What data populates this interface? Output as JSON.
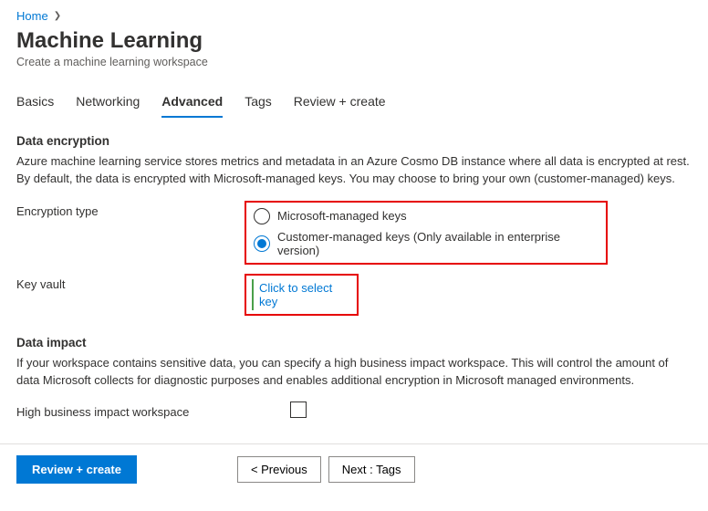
{
  "breadcrumb": {
    "home": "Home"
  },
  "header": {
    "title": "Machine Learning",
    "subtitle": "Create a machine learning workspace"
  },
  "tabs": {
    "basics": "Basics",
    "networking": "Networking",
    "advanced": "Advanced",
    "tags": "Tags",
    "review": "Review + create"
  },
  "encryption": {
    "section_title": "Data encryption",
    "desc": "Azure machine learning service stores metrics and metadata in an Azure Cosmo DB instance where all data is encrypted at rest. By default, the data is encrypted with Microsoft-managed keys. You may choose to bring your own (customer-managed) keys.",
    "type_label": "Encryption type",
    "option_microsoft": "Microsoft-managed keys",
    "option_customer": "Customer-managed keys (Only available in enterprise version)",
    "keyvault_label": "Key vault",
    "select_key_link": "Click to select key"
  },
  "impact": {
    "section_title": "Data impact",
    "desc": "If your workspace contains sensitive data, you can specify a high business impact workspace. This will control the amount of data Microsoft collects for diagnostic purposes and enables additional encryption in Microsoft managed environments.",
    "hbi_label": "High business impact workspace"
  },
  "footer": {
    "review": "Review + create",
    "previous": "<  Previous",
    "next": "Next : Tags"
  }
}
